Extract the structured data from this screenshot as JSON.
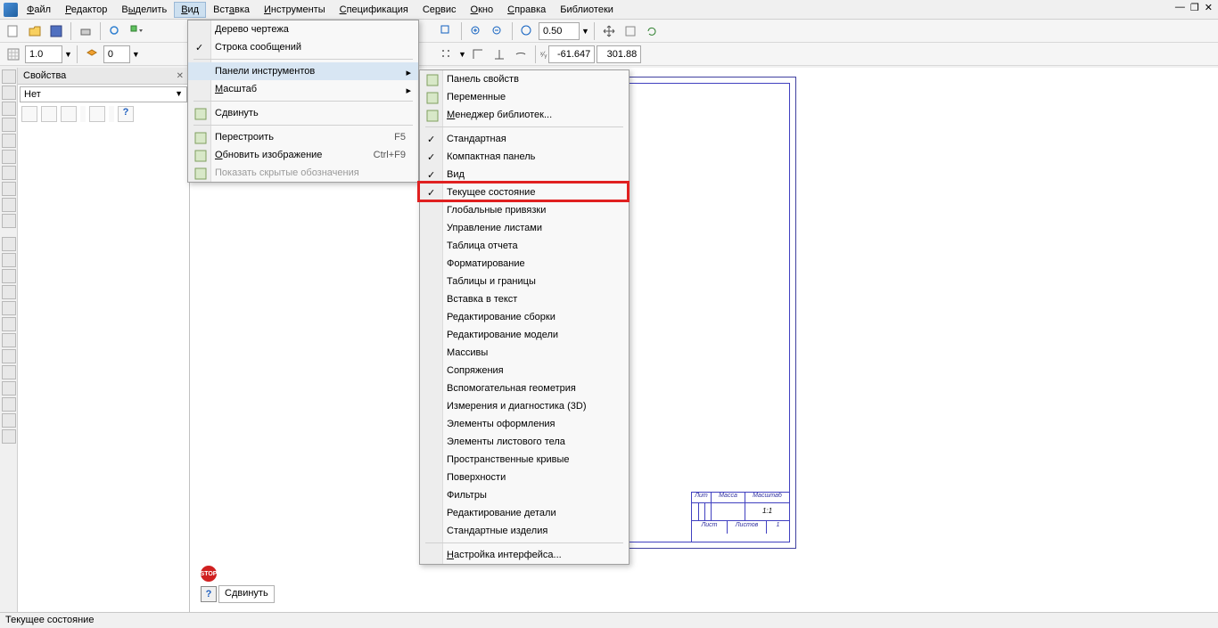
{
  "menubar": {
    "items": [
      {
        "label": "Файл",
        "u": 0
      },
      {
        "label": "Редактор",
        "u": 0
      },
      {
        "label": "Выделить",
        "u": 1
      },
      {
        "label": "Вид",
        "u": 0,
        "active": true
      },
      {
        "label": "Вставка",
        "u": 3
      },
      {
        "label": "Инструменты",
        "u": 0
      },
      {
        "label": "Спецификация",
        "u": 0
      },
      {
        "label": "Сервис",
        "u": 2
      },
      {
        "label": "Окно",
        "u": 0
      },
      {
        "label": "Справка",
        "u": 0
      },
      {
        "label": "Библиотеки",
        "u": -1
      }
    ]
  },
  "window_controls": {
    "min": "—",
    "restore": "❐",
    "close": "✕"
  },
  "toolbar1": {
    "zoom_value": "0.50"
  },
  "toolbar2": {
    "scale_value": "1.0",
    "page_value": "0",
    "coord_x": "-61.647",
    "coord_y": "301.88"
  },
  "props": {
    "title": "Свойства",
    "dropdown": "Нет"
  },
  "view_menu": {
    "items": [
      {
        "label": "Дерево чертежа"
      },
      {
        "label": "Строка сообщений",
        "checked": true
      },
      {
        "sep": true
      },
      {
        "label": "Панели инструментов",
        "arrow": true,
        "hl": true
      },
      {
        "label": "Масштаб",
        "u": 0,
        "arrow": true
      },
      {
        "sep": true
      },
      {
        "label": "Сдвинуть",
        "icon": "move-icon"
      },
      {
        "sep": true
      },
      {
        "label": "Перестроить",
        "icon": "rebuild-icon",
        "short": "F5"
      },
      {
        "label": "Обновить изображение",
        "u": 0,
        "icon": "refresh-icon",
        "short": "Ctrl+F9"
      },
      {
        "label": "Показать скрытые обозначения",
        "icon": "show-hidden-icon",
        "disabled": true
      }
    ]
  },
  "toolbars_menu": {
    "items": [
      {
        "label": "Панель свойств",
        "icon": "props-panel-icon"
      },
      {
        "label": "Переменные",
        "icon": "vars-icon"
      },
      {
        "label": "Менеджер библиотек...",
        "u": 0,
        "icon": "libmgr-icon"
      },
      {
        "sep": true
      },
      {
        "label": "Стандартная",
        "checked": true
      },
      {
        "label": "Компактная панель",
        "checked": true
      },
      {
        "label": "Вид",
        "checked": true
      },
      {
        "label": "Текущее состояние",
        "checked": true,
        "red": true
      },
      {
        "label": "Глобальные привязки"
      },
      {
        "label": "Управление листами"
      },
      {
        "label": "Таблица отчета"
      },
      {
        "label": "Форматирование"
      },
      {
        "label": "Таблицы и границы"
      },
      {
        "label": "Вставка в текст"
      },
      {
        "label": "Редактирование сборки"
      },
      {
        "label": "Редактирование модели"
      },
      {
        "label": "Массивы"
      },
      {
        "label": "Сопряжения"
      },
      {
        "label": "Вспомогательная геометрия"
      },
      {
        "label": "Измерения и диагностика (3D)"
      },
      {
        "label": "Элементы оформления"
      },
      {
        "label": "Элементы листового тела"
      },
      {
        "label": "Пространственные кривые"
      },
      {
        "label": "Поверхности"
      },
      {
        "label": "Фильтры"
      },
      {
        "label": "Редактирование детали"
      },
      {
        "label": "Стандартные изделия"
      },
      {
        "sep": true
      },
      {
        "label": "Настройка интерфейса...",
        "u": 0
      }
    ]
  },
  "bottom": {
    "move_label": "Сдвинуть",
    "help": "?"
  },
  "title_block": {
    "h1": "Лит",
    "h2": "Масса",
    "h3": "Масштаб",
    "v_scale": "1:1",
    "f1": "Лист",
    "f2": "Листов",
    "f2v": "1"
  },
  "statusbar": {
    "text": "Текущее состояние"
  }
}
